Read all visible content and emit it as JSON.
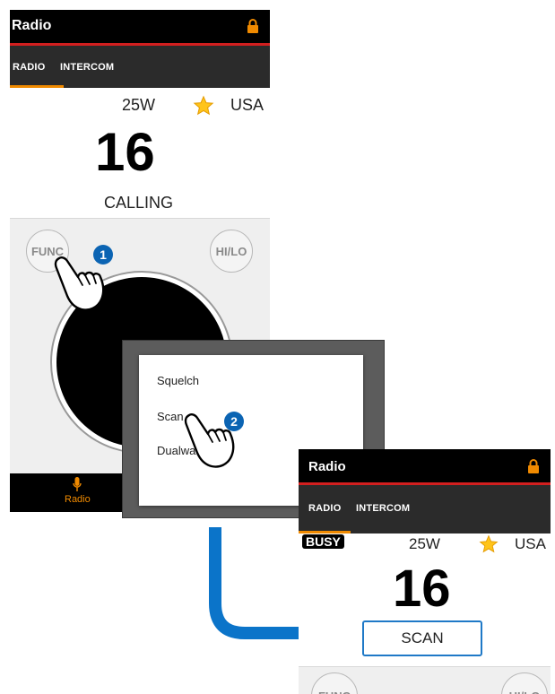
{
  "screen1": {
    "title": "Radio",
    "tabs": [
      "RADIO",
      "INTERCOM"
    ],
    "power": "25W",
    "region": "USA",
    "channel": "16",
    "channel_name": "CALLING",
    "func_button": "FUNC",
    "hilo_button": "HI/LO",
    "nav_label": "Radio"
  },
  "popup_menu": {
    "items": [
      "Squelch",
      "Scan",
      "Dualwa"
    ]
  },
  "screen2": {
    "title": "Radio",
    "tabs": [
      "RADIO",
      "INTERCOM"
    ],
    "busy_badge": "BUSY",
    "power": "25W",
    "region": "USA",
    "channel": "16",
    "mode": "SCAN",
    "func_button": "FUNC",
    "hilo_button": "HI/LO"
  },
  "callouts": [
    "1",
    "2"
  ],
  "icons": [
    "lock-icon",
    "star-icon",
    "microphone-icon",
    "hand-pointer-icon",
    "arrow-icon"
  ],
  "colors": {
    "accent": "#f08a00",
    "red_line": "#d21f1f",
    "title_bg": "#000000",
    "tab_bg": "#2b2b2b",
    "callout": "#0b64b3",
    "arrow": "#0b74c9"
  }
}
